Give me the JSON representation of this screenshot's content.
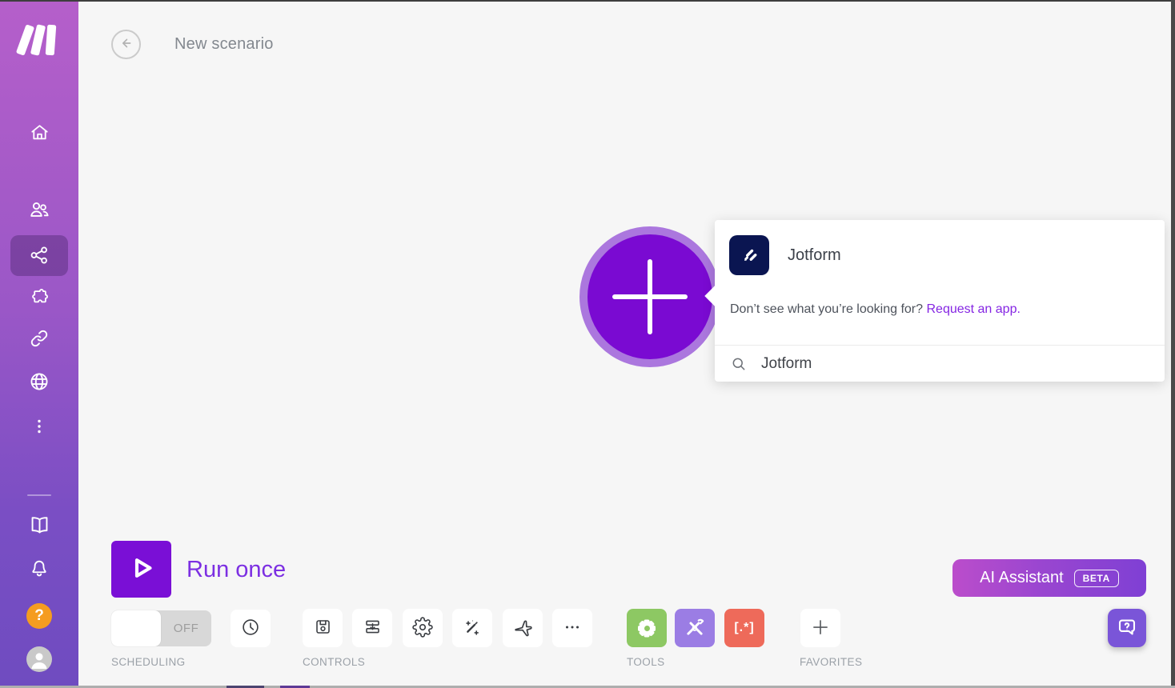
{
  "header": {
    "title": "New scenario"
  },
  "sidebar": {
    "logo_icon": "make-logo",
    "items": [
      {
        "id": "home",
        "icon": "home-icon",
        "active": false
      },
      {
        "id": "team",
        "icon": "team-icon",
        "active": false
      },
      {
        "id": "scenarios",
        "icon": "scenarios-share-icon",
        "active": true
      },
      {
        "id": "templates",
        "icon": "puzzle-icon",
        "active": false
      },
      {
        "id": "connections",
        "icon": "link-icon",
        "active": false
      },
      {
        "id": "webhooks",
        "icon": "globe-icon",
        "active": false
      },
      {
        "id": "more",
        "icon": "kebab-menu-icon",
        "active": false
      }
    ],
    "bottom_items": [
      {
        "id": "docs",
        "icon": "book-icon"
      },
      {
        "id": "notifications",
        "icon": "bell-icon"
      },
      {
        "id": "help",
        "icon": "question-icon",
        "label": "?"
      },
      {
        "id": "profile",
        "icon": "avatar-icon"
      }
    ]
  },
  "canvas": {
    "add_module_icon": "plus-icon"
  },
  "app_popup": {
    "app_name": "Jotform",
    "app_icon": "jotform-icon",
    "app_icon_color": "#0a1551",
    "hint_text": "Don’t see what you’re looking for?",
    "hint_link": "Request an app.",
    "search_icon": "search-icon",
    "search_value": "Jotform"
  },
  "footer": {
    "run_button_label": "Run once",
    "scheduling_toggle": "OFF",
    "sections": {
      "scheduling": "SCHEDULING",
      "controls": "CONTROLS",
      "tools": "TOOLS",
      "favorites": "FAVORITES"
    },
    "controls_icons": [
      "save-icon",
      "import-blueprint-icon",
      "settings-gear-icon",
      "magic-wand-icon",
      "airplane-icon",
      "more-ellipsis-icon"
    ],
    "tools_icons": [
      "gear-solid-icon",
      "wrench-tools-icon",
      "regex-text-parser-icon"
    ],
    "tools_regex_glyph": "[.*]",
    "favorites_icon": "plus-icon",
    "ai_assistant_label": "AI Assistant",
    "ai_assistant_badge": "BETA",
    "help_fab_icon": "help-bubble-icon"
  },
  "colors": {
    "accent_purple": "#7a0fd6",
    "sidebar_gradient_top": "#b55fca",
    "sidebar_gradient_bottom": "#6f4cc0",
    "circle_ring": "#ab77de",
    "link_purple": "#8526e3",
    "run_label_purple": "#7c2fe2",
    "tool_green": "#8dc863",
    "tool_purple": "#9b7de4",
    "tool_red": "#ee6a5a",
    "jotform_navy": "#0a1551",
    "help_orange": "#f59c20",
    "ai_gradient": [
      "#bb4dcb",
      "#7f40d4"
    ]
  }
}
